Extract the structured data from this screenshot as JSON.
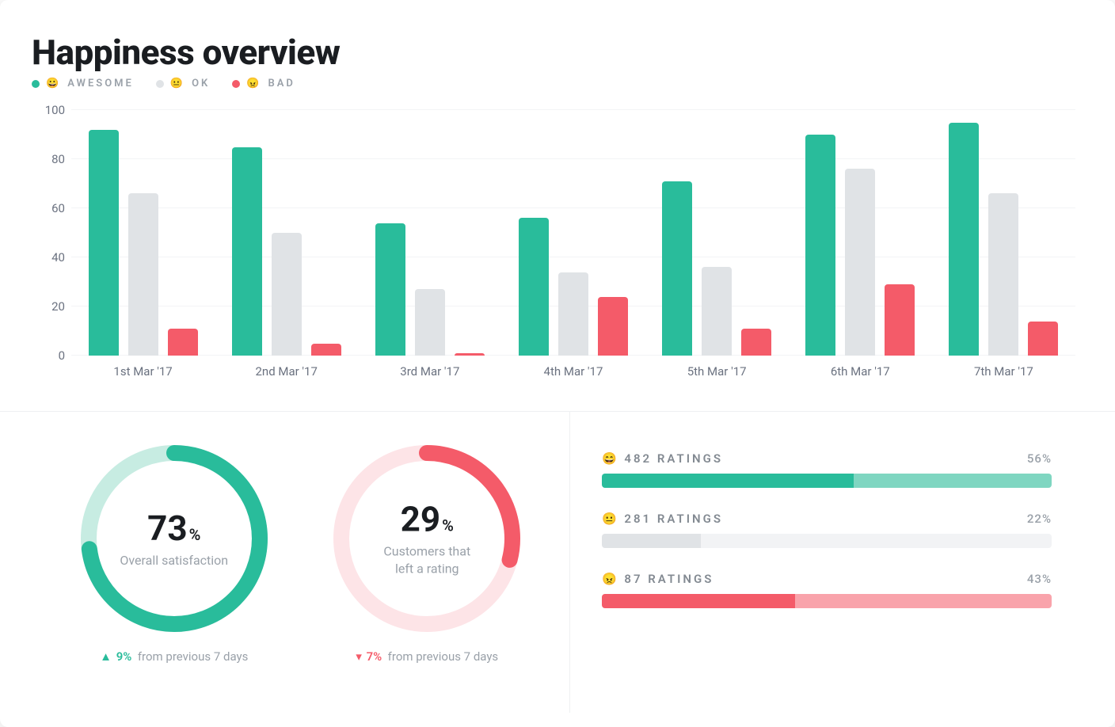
{
  "title": "Happiness overview",
  "legend": {
    "awesome": {
      "emoji": "😀",
      "label": "AWESOME",
      "color": "#29bc9b"
    },
    "ok": {
      "emoji": "😐",
      "label": "OK",
      "color": "#e0e3e6"
    },
    "bad": {
      "emoji": "😠",
      "label": "BAD",
      "color": "#f45b69"
    }
  },
  "chart_data": {
    "type": "bar",
    "title": "Happiness overview",
    "xlabel": "",
    "ylabel": "",
    "ylim": [
      0,
      100
    ],
    "yticks": [
      0,
      20,
      40,
      60,
      80,
      100
    ],
    "categories": [
      "1st Mar '17",
      "2nd Mar '17",
      "3rd Mar '17",
      "4th Mar '17",
      "5th Mar '17",
      "6th Mar '17",
      "7th Mar '17"
    ],
    "series": [
      {
        "name": "AWESOME",
        "color": "#29bc9b",
        "values": [
          92,
          85,
          54,
          56,
          71,
          90,
          95
        ]
      },
      {
        "name": "OK",
        "color": "#e0e3e6",
        "values": [
          66,
          50,
          27,
          34,
          36,
          76,
          66
        ]
      },
      {
        "name": "BAD",
        "color": "#f45b69",
        "values": [
          11,
          5,
          1,
          24,
          11,
          29,
          14
        ]
      }
    ]
  },
  "gauges": {
    "satisfaction": {
      "value": 73,
      "unit": "%",
      "label": "Overall satisfaction",
      "color": "#29bc9b",
      "track": "#c7ece2",
      "delta_dir": "up",
      "delta_value": "9%",
      "delta_text": "from previous 7 days"
    },
    "responders": {
      "value": 29,
      "unit": "%",
      "label": "Customers that\nleft a rating",
      "color": "#f45b69",
      "track": "#fde4e7",
      "delta_dir": "down",
      "delta_value": "7%",
      "delta_text": "from previous 7 days"
    }
  },
  "ratings": [
    {
      "emoji": "😄",
      "count": 482,
      "label": "RATINGS",
      "percent": 56,
      "fill": "#29bc9b",
      "rest": "#7fd6c1"
    },
    {
      "emoji": "😐",
      "count": 281,
      "label": "RATINGS",
      "percent": 22,
      "fill": "#e0e3e6",
      "rest": "#f2f3f5"
    },
    {
      "emoji": "😠",
      "count": 87,
      "label": "RATINGS",
      "percent": 43,
      "fill": "#f45b69",
      "rest": "#f9a3ab"
    }
  ]
}
